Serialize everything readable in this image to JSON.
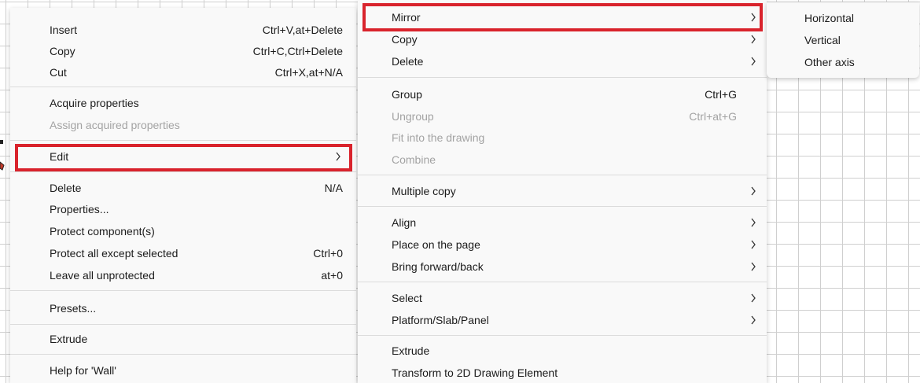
{
  "colors": {
    "highlight_border": "#d9232c",
    "menu_bg": "#f9f9f9",
    "active_row_bg": "#ebebeb",
    "disabled_text": "#a3a3a3",
    "grid_line": "#cfcfcf"
  },
  "icons": {
    "submenu_arrow": "chevron-right-icon"
  },
  "main_menu": {
    "items": [
      {
        "label": "Insert",
        "shortcut": "Ctrl+V,at+Delete"
      },
      {
        "label": "Copy",
        "shortcut": "Ctrl+C,Ctrl+Delete"
      },
      {
        "label": "Cut",
        "shortcut": "Ctrl+X,at+N/A"
      },
      {
        "label": "Acquire properties"
      },
      {
        "label": "Assign acquired properties",
        "disabled": true
      },
      {
        "label": "Edit",
        "submenu": true,
        "active": true,
        "highlighted": true
      },
      {
        "label": "Delete",
        "shortcut": "N/A"
      },
      {
        "label": "Properties..."
      },
      {
        "label": "Protect component(s)"
      },
      {
        "label": "Protect all except selected",
        "shortcut": "Ctrl+0"
      },
      {
        "label": "Leave all unprotected",
        "shortcut": "at+0"
      },
      {
        "label": "Presets..."
      },
      {
        "label": "Extrude"
      },
      {
        "label": "Help for 'Wall'"
      }
    ]
  },
  "edit_submenu": {
    "items": [
      {
        "label": "Mirror",
        "submenu": true,
        "active": true,
        "highlighted": true
      },
      {
        "label": "Copy",
        "submenu": true
      },
      {
        "label": "Delete",
        "submenu": true
      },
      {
        "label": "Group",
        "shortcut": "Ctrl+G"
      },
      {
        "label": "Ungroup",
        "shortcut": "Ctrl+at+G",
        "disabled": true
      },
      {
        "label": "Fit into the drawing",
        "disabled": true
      },
      {
        "label": "Combine",
        "disabled": true
      },
      {
        "label": "Multiple copy",
        "submenu": true
      },
      {
        "label": "Align",
        "submenu": true
      },
      {
        "label": "Place on the page",
        "submenu": true
      },
      {
        "label": "Bring forward/back",
        "submenu": true
      },
      {
        "label": "Select",
        "submenu": true
      },
      {
        "label": "Platform/Slab/Panel",
        "submenu": true
      },
      {
        "label": "Extrude"
      },
      {
        "label": "Transform to 2D Drawing Element"
      }
    ]
  },
  "mirror_submenu": {
    "items": [
      {
        "label": "Horizontal"
      },
      {
        "label": "Vertical"
      },
      {
        "label": "Other axis"
      }
    ]
  }
}
